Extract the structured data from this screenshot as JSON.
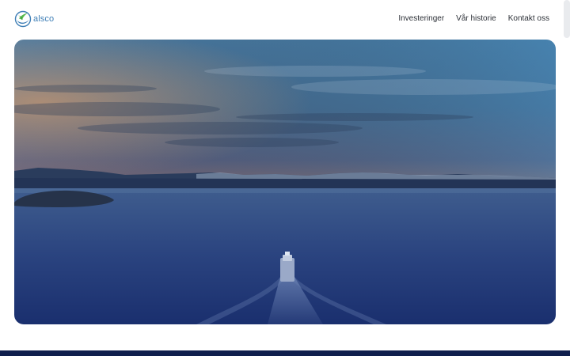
{
  "brand": {
    "name": "alsco",
    "logo_icon": "alsco-logo-mark-icon",
    "primary_color": "#3f7fb6",
    "accent_color": "#55b84a"
  },
  "nav": {
    "items": [
      {
        "label": "Investeringer"
      },
      {
        "label": "Vår historie"
      },
      {
        "label": "Kontakt oss"
      }
    ]
  },
  "hero": {
    "media_subject": "ship-on-fjord-at-dusk",
    "tint_color": "#1a2f6e"
  },
  "footer": {
    "band_color": "#0f1f4d"
  }
}
